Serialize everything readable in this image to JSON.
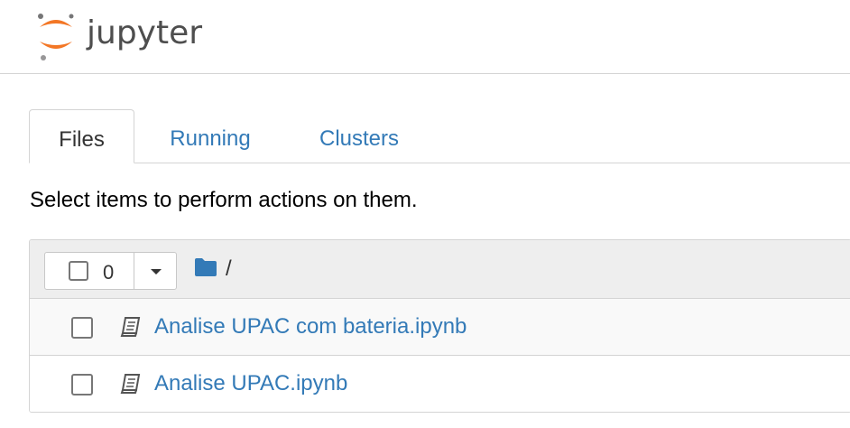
{
  "header": {
    "logo_text": "jupyter",
    "logo_icon": "jupyter-logo-icon"
  },
  "tabs": [
    {
      "label": "Files",
      "active": true
    },
    {
      "label": "Running",
      "active": false
    },
    {
      "label": "Clusters",
      "active": false
    }
  ],
  "instructions": "Select items to perform actions on them.",
  "file_list": {
    "selected_count": "0",
    "breadcrumb": "/",
    "items": [
      {
        "name": "Analise UPAC com bateria.ipynb",
        "icon": "notebook-icon"
      },
      {
        "name": "Analise UPAC.ipynb",
        "icon": "notebook-icon"
      }
    ]
  },
  "colors": {
    "link": "#337ab7",
    "jupyter_orange": "#f37726",
    "logo_text": "#4e4e4e"
  }
}
